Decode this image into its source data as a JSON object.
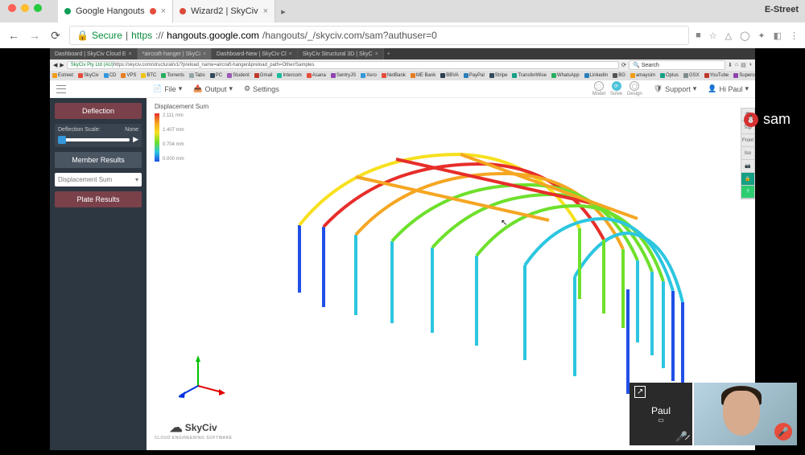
{
  "mac": {
    "menu_right": "E-Street"
  },
  "chrome": {
    "tabs": [
      {
        "label": "Google Hangouts",
        "active": true,
        "recording": true
      },
      {
        "label": "Wizard2 | SkyCiv",
        "active": false
      }
    ],
    "address": {
      "secure": "Secure",
      "proto": "https",
      "host_pre": "://",
      "host": "hangouts.google.com",
      "path": "/hangouts/_/skyciv.com/sam?authuser=0"
    },
    "icons": {
      "cam": "▮",
      "star": "☆",
      "menu": "⋮"
    }
  },
  "firefox": {
    "tabs": [
      "Dashboard | SkyCiv Cloud E",
      "*aircraft-hanger | SkyCi",
      "Dashboard-New | SkyCiv Cl",
      "SkyCiv Structural 3D | SkyC"
    ],
    "active_tab_index": 1,
    "url_prefix": "SkyCiv Pty Ltd (AU)",
    "url": "https://skyciv.com/structural/v1/?preload_name=aircraft-hanger&preload_path=Other/Samples",
    "search_placeholder": "Search",
    "bookmarks": [
      "Estreet",
      "SkyCiv",
      "CD",
      "VPS",
      "BTC",
      "Torrents",
      "Tabs",
      "PC",
      "Student",
      "Gmail",
      "Intercom",
      "Asana",
      "SentryJS",
      "Xero",
      "NetBank",
      "ME Bank",
      "BBVA",
      "PayPal",
      "Stripe",
      "TransferWise",
      "WhatsApp",
      "LinkedIn",
      "BG",
      "amaysim",
      "Optus",
      "GSX",
      "YouTube",
      "Supercoach"
    ]
  },
  "app": {
    "topbar": {
      "file": "File",
      "output": "Output",
      "settings": "Settings",
      "stages": [
        "Model",
        "Solve",
        "Design"
      ],
      "support": "Support",
      "user": "Hi Paul"
    },
    "left": {
      "deflection": "Deflection",
      "scale_label": "Deflection Scale:",
      "scale_value": "None",
      "member_results": "Member Results",
      "dropdown": "Displacement Sum",
      "plate_results": "Plate Results"
    },
    "legend": {
      "title": "Displacement Sum",
      "v0": "2.111 mm",
      "v1": "1.407 mm",
      "v2": "0.704 mm",
      "v3": "0.000 mm"
    },
    "right_tools": [
      "👁",
      "Top",
      "Front",
      "Iso",
      "📷",
      "🔒",
      "?"
    ],
    "logo": "SkyCiv",
    "logo_sub": "CLOUD ENGINEERING SOFTWARE"
  },
  "hangouts": {
    "sam": "sam",
    "paul": "Paul"
  }
}
